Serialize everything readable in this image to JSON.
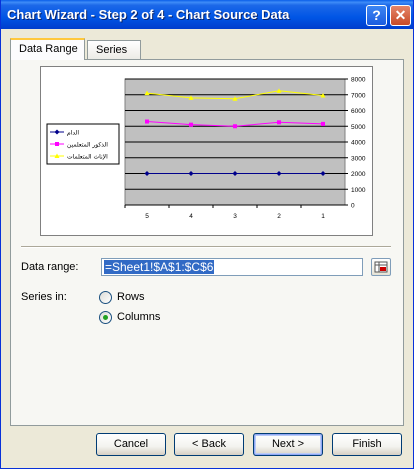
{
  "window": {
    "title": "Chart Wizard - Step 2 of 4 - Chart Source Data"
  },
  "title_buttons": {
    "help": "?",
    "close": "✕"
  },
  "tabs": [
    {
      "label": "Data Range",
      "active": true
    },
    {
      "label": "Series",
      "active": false
    }
  ],
  "form": {
    "data_range_label": "Data range:",
    "data_range_value": "=Sheet1!$A$1:$C$6",
    "series_in_label": "Series in:",
    "rows_label": "Rows",
    "rows_selected": false,
    "columns_label": "Columns",
    "columns_selected": true
  },
  "buttons": {
    "cancel": "Cancel",
    "back": "Back",
    "back_prefix": "< ",
    "next": "Next",
    "next_suffix": " >",
    "finish": "Finish"
  },
  "chart_data": {
    "type": "line",
    "categories": [
      "5",
      "4",
      "3",
      "2",
      "1"
    ],
    "series": [
      {
        "name": "الدام",
        "color": "#00008b",
        "marker": "diamond",
        "values": [
          2000,
          2000,
          2000,
          2000,
          2000
        ]
      },
      {
        "name": "الذكور المتعلمين",
        "color": "#ff00ff",
        "marker": "square",
        "values": [
          5300,
          5100,
          5000,
          5250,
          5150
        ]
      },
      {
        "name": "الإناث المتعلمات",
        "color": "#ffff00",
        "marker": "triangle",
        "values": [
          7100,
          6800,
          6750,
          7250,
          6950
        ]
      }
    ],
    "y_ticks": [
      "0",
      "1000",
      "2000",
      "3000",
      "4000",
      "5000",
      "6000",
      "7000",
      "8000"
    ],
    "ylim": [
      0,
      8000
    ],
    "y_axis_side": "right",
    "plot_background": "#c0c0c0",
    "grid": true,
    "legend_position": "left"
  }
}
